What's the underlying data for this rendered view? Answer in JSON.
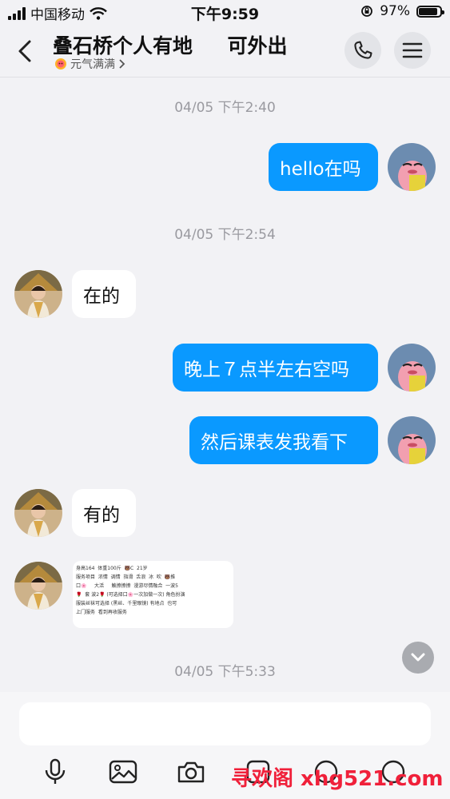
{
  "status_bar": {
    "carrier": "中国移动",
    "time": "下午9:59",
    "battery_label": "97%",
    "battery_level": 0.97
  },
  "header": {
    "title": "叠石桥个人有地     可外出",
    "subtitle": "元气满满"
  },
  "chat": {
    "timestamps": [
      "04/05 下午2:40",
      "04/05 下午2:54",
      "04/05 下午5:33"
    ],
    "messages": [
      {
        "side": "out",
        "text": "hello在吗"
      },
      {
        "side": "in",
        "text": "在的"
      },
      {
        "side": "out",
        "text": "晚上７点半左右空吗"
      },
      {
        "side": "out",
        "text": "然后课表发我看下"
      },
      {
        "side": "in",
        "text": "有的"
      }
    ],
    "image_message_text": "身高164  体重100斤  🐻C  21岁\n服务项目  浓情  调情  指滑  舌浪  冰  吹  🐻推\n口🌸     大活     触撩撩撩  漫游尽情融合  一波5\n🌹  套 波2🌹 (可选择口🌸一次加做一次) 角色扮演\n服装丝袜可选择 (黑丝、千里眼镜) 有地点  也可\n上门服务  看到再收服务"
  },
  "watermark": "寻欢阁 xhg521.com",
  "colors": {
    "outgoing_bubble": "#0a99ff",
    "background": "#f2f2f5",
    "watermark": "#f0203a"
  }
}
